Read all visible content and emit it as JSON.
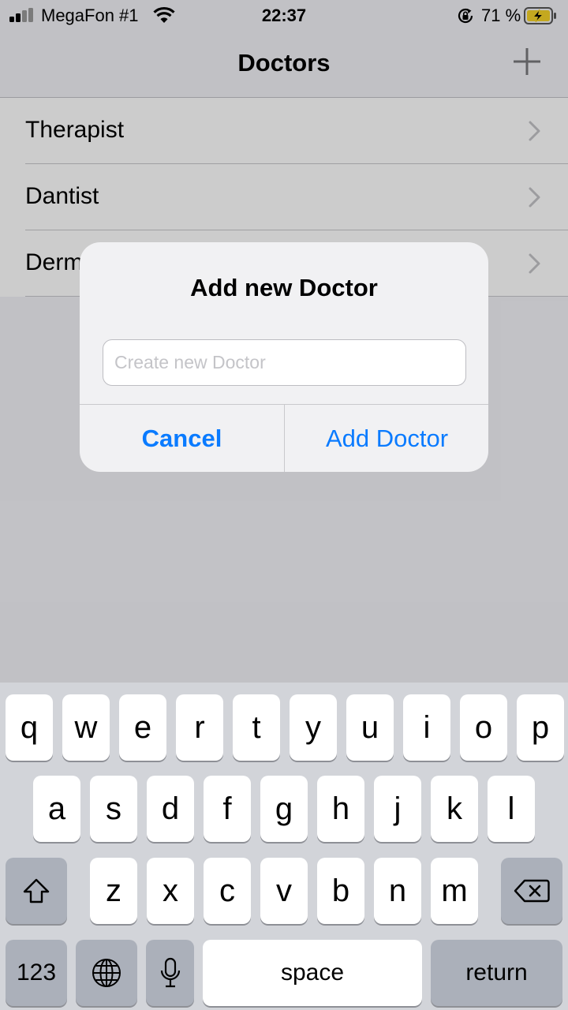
{
  "status_bar": {
    "carrier": "MegaFon #1",
    "time": "22:37",
    "battery_percent": "71 %"
  },
  "nav": {
    "title": "Doctors",
    "add_icon": "plus-icon"
  },
  "list": {
    "items": [
      {
        "label": "Therapist"
      },
      {
        "label": "Dantist"
      },
      {
        "label": "Derm"
      }
    ]
  },
  "alert": {
    "title": "Add new Doctor",
    "input_value": "",
    "input_placeholder": "Create new Doctor",
    "cancel_label": "Cancel",
    "confirm_label": "Add Doctor",
    "button_color": "#0a7bff"
  },
  "keyboard": {
    "row1": [
      "q",
      "w",
      "e",
      "r",
      "t",
      "y",
      "u",
      "i",
      "o",
      "p"
    ],
    "row2": [
      "a",
      "s",
      "d",
      "f",
      "g",
      "h",
      "j",
      "k",
      "l"
    ],
    "row3": [
      "z",
      "x",
      "c",
      "v",
      "b",
      "n",
      "m"
    ],
    "shift_icon": "shift-icon",
    "delete_icon": "backspace-icon",
    "numbers_label": "123",
    "globe_icon": "globe-icon",
    "mic_icon": "microphone-icon",
    "space_label": "space",
    "return_label": "return"
  }
}
